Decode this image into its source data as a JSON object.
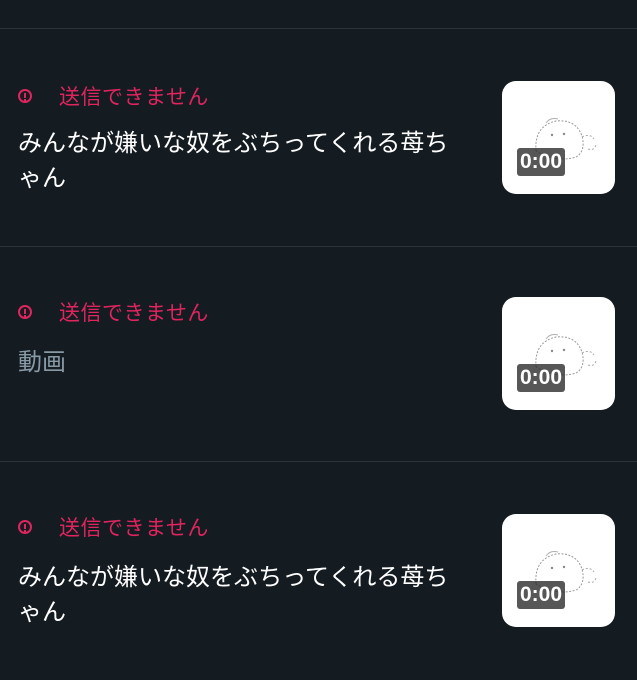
{
  "messages": [
    {
      "error_label": "送信できません",
      "text": "みんなが嫌いな奴をぶちってくれる苺ちゃん",
      "video_duration": "0:00",
      "text_muted": false
    },
    {
      "error_label": "送信できません",
      "text": "動画",
      "video_duration": "0:00",
      "text_muted": true
    },
    {
      "error_label": "送信できません",
      "text": "みんなが嫌いな奴をぶちってくれる苺ちゃん",
      "video_duration": "0:00",
      "text_muted": false
    }
  ],
  "icons": {
    "error": "alert-circle-icon"
  },
  "colors": {
    "background": "#141c21",
    "error": "#e0245e",
    "text": "#ffffff",
    "muted_text": "#8899a6"
  }
}
